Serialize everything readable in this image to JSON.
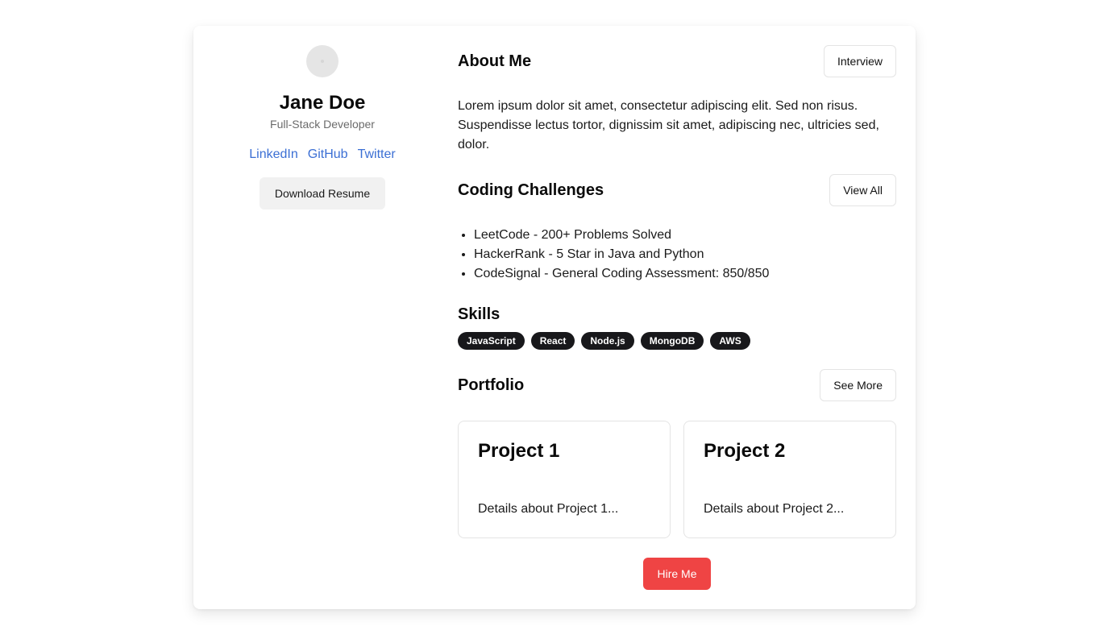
{
  "profile": {
    "name": "Jane Doe",
    "role": "Full-Stack Developer",
    "links": [
      "LinkedIn",
      "GitHub",
      "Twitter"
    ],
    "download_label": "Download Resume"
  },
  "about": {
    "title": "About Me",
    "button_label": "Interview",
    "text": "Lorem ipsum dolor sit amet, consectetur adipiscing elit. Sed non risus. Suspendisse lectus tortor, dignissim sit amet, adipiscing nec, ultricies sed, dolor."
  },
  "challenges": {
    "title": "Coding Challenges",
    "button_label": "View All",
    "items": [
      "LeetCode - 200+ Problems Solved",
      "HackerRank - 5 Star in Java and Python",
      "CodeSignal - General Coding Assessment: 850/850"
    ]
  },
  "skills": {
    "title": "Skills",
    "items": [
      "JavaScript",
      "React",
      "Node.js",
      "MongoDB",
      "AWS"
    ]
  },
  "portfolio": {
    "title": "Portfolio",
    "button_label": "See More",
    "projects": [
      {
        "title": "Project 1",
        "details": "Details about Project 1..."
      },
      {
        "title": "Project 2",
        "details": "Details about Project 2..."
      }
    ]
  },
  "hire_label": "Hire Me",
  "colors": {
    "link": "#3b6fd4",
    "badge": "#18181b",
    "hire": "#ef4444"
  }
}
